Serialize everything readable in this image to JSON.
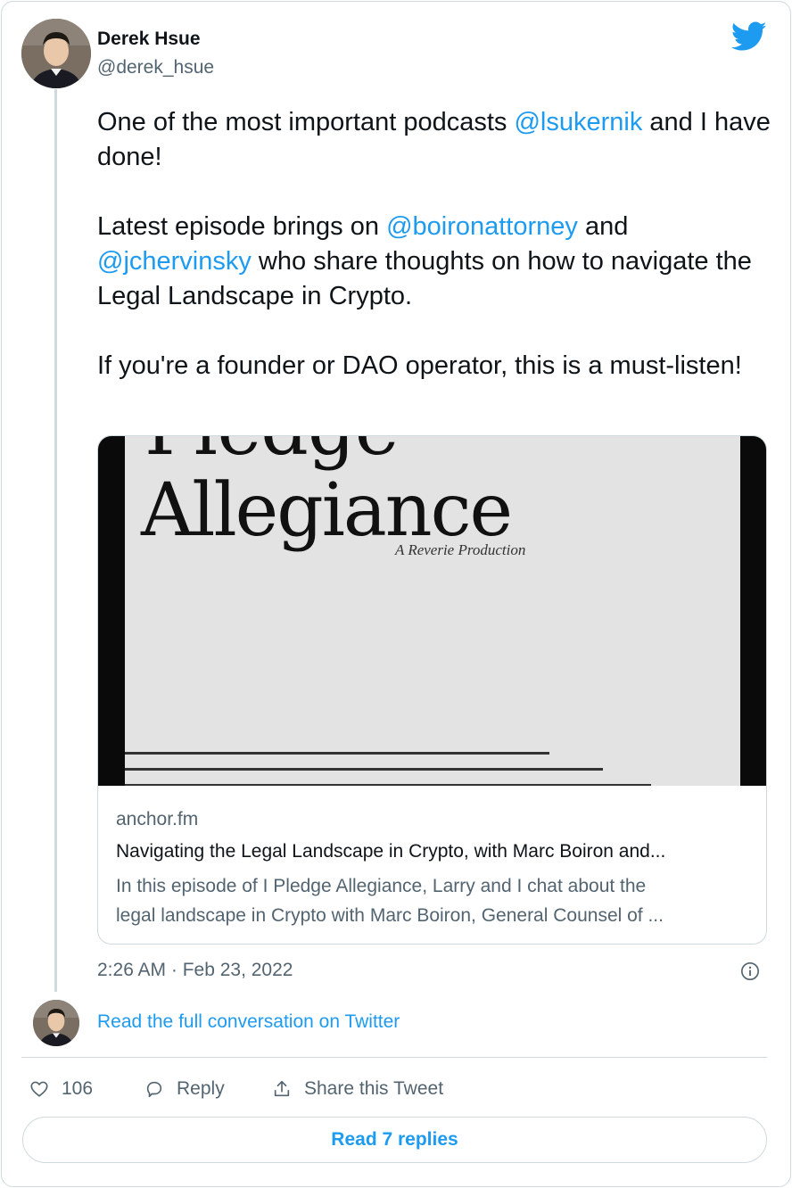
{
  "author": {
    "name": "Derek Hsue",
    "handle": "@derek_hsue",
    "avatar_icon": "avatar-photo"
  },
  "brand_icon": "twitter-bird-icon",
  "colors": {
    "accent": "#1d9bf0",
    "text": "#0f1419",
    "muted": "#536471",
    "border": "#cfd9de"
  },
  "tweet": {
    "p1_a": "One of the most important podcasts ",
    "p1_mention": "@lsukernik",
    "p1_b": " and I have done!",
    "p2_a": "Latest episode brings on ",
    "p2_mention1": "@boironattorney",
    "p2_b": " and ",
    "p2_mention2": "@jchervinsky",
    "p2_c": " who share thoughts on how to navigate the Legal Landscape in Crypto.",
    "p3": "If you're a founder or DAO operator, this is a must-listen!"
  },
  "link_card": {
    "image_text_top": "Pledge",
    "image_text_main": "Allegiance",
    "image_text_sub": "A Reverie Production",
    "domain": "anchor.fm",
    "title": "Navigating the Legal Landscape in Crypto, with Marc Boiron and...",
    "desc_line1": "In this episode of I Pledge Allegiance, Larry and I chat about the",
    "desc_line2": "legal landscape in Crypto with Marc Boiron, General Counsel of ..."
  },
  "timestamp": "2:26 AM · Feb 23, 2022",
  "read_full_label": "Read the full conversation on Twitter",
  "actions": {
    "like_count": "106",
    "reply_label": "Reply",
    "share_label": "Share this Tweet"
  },
  "read_replies_label": "Read 7 replies"
}
